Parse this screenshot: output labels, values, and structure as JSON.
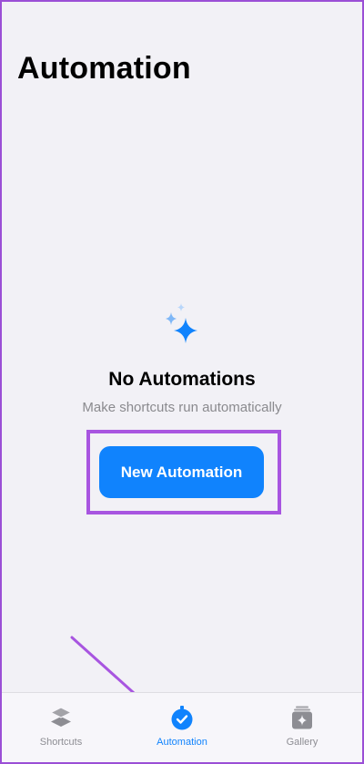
{
  "header": {
    "title": "Automation"
  },
  "empty_state": {
    "icon": "sparkles-icon",
    "title": "No Automations",
    "subtitle": "Make shortcuts run automatically",
    "button_label": "New Automation"
  },
  "tabbar": {
    "tabs": [
      {
        "label": "Shortcuts",
        "icon": "layers-icon",
        "active": false
      },
      {
        "label": "Automation",
        "icon": "clock-check-icon",
        "active": true
      },
      {
        "label": "Gallery",
        "icon": "gallery-icon",
        "active": false
      }
    ]
  },
  "colors": {
    "accent": "#1083fd",
    "background": "#f2f1f6",
    "annotation": "#a855e0",
    "inactive_tab": "#8d8d93"
  }
}
